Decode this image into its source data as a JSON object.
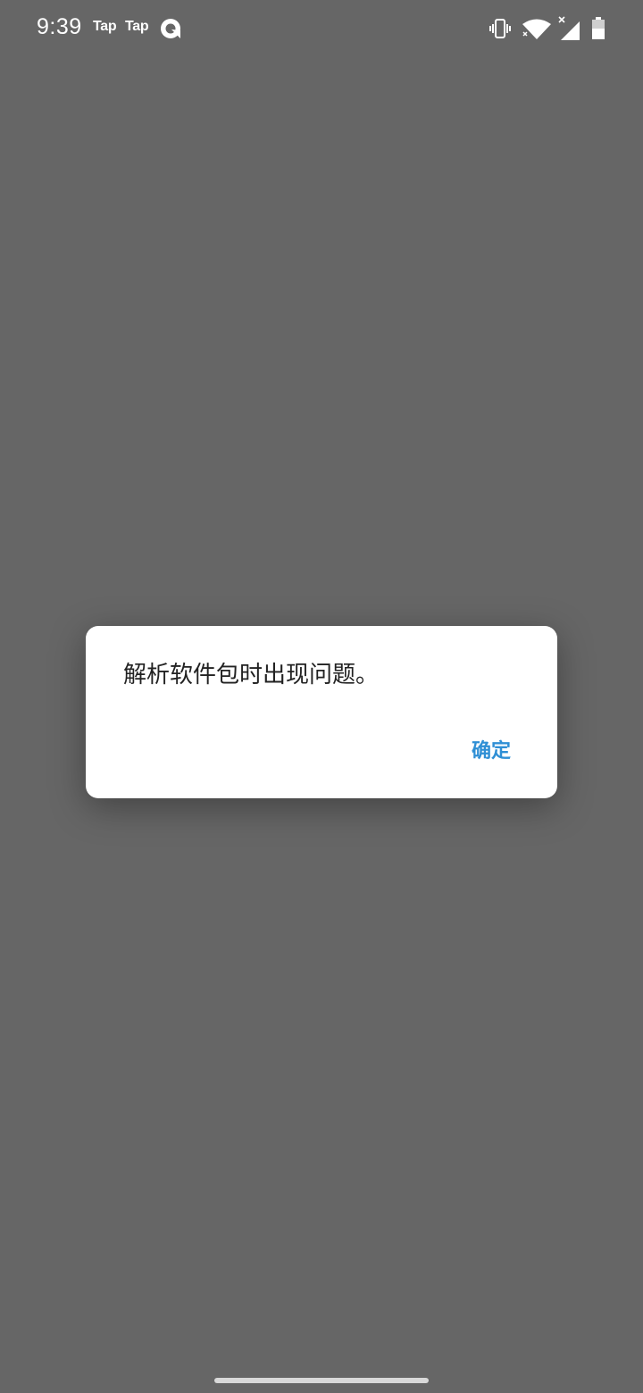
{
  "status_bar": {
    "time": "9:39",
    "notifications": [
      "Tap",
      "Tap"
    ],
    "notification_icon": "q-app-icon",
    "system_icons": [
      "vibrate-icon",
      "wifi-icon",
      "signal-icon",
      "battery-icon"
    ],
    "icon_color": "#ffffff"
  },
  "dialog": {
    "message": "解析软件包时出现问题。",
    "ok_label": "确定",
    "accent_color": "#2f8fd5"
  },
  "background_color": "#666666"
}
